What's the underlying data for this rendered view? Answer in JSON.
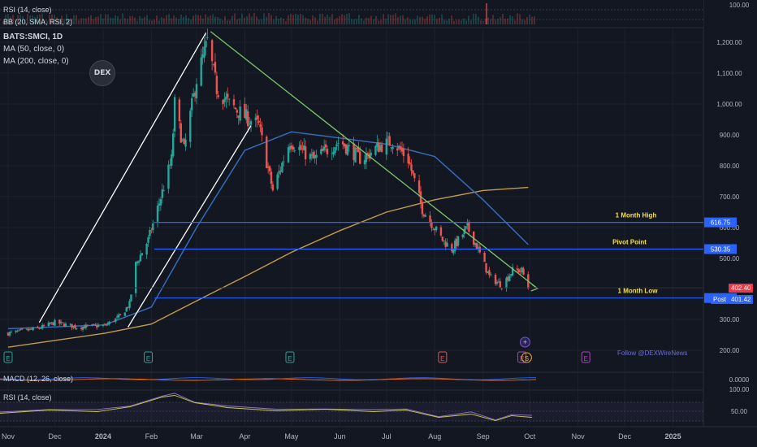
{
  "colors": {
    "background": "#131722",
    "grid": "#1e222d",
    "axis_text": "#b2b5be",
    "candle_up": "#26a69a",
    "candle_down": "#ef5350",
    "ma50": "#3a6fbf",
    "ma200": "#c29c4a",
    "level_line": "#2962ff",
    "trendline_green": "#7cc46b",
    "trendline_white": "#ffffff",
    "level_label": "#f5e342",
    "macd_line": "#2962ff",
    "signal_line": "#ff6d00",
    "rsi_line": "#9575cd",
    "rsi_ma": "#c6cc4a"
  },
  "header": {
    "symbol": "BATS:SMCI, 1D",
    "ma50_label": "MA (50, close, 0)",
    "ma200_label": "MA (200, close, 0)",
    "rsi_top_label": "RSI (14, close)",
    "bb_top_label": "BB (20, SMA, RSI, 2)",
    "macd_label": "MACD (12, 26, close)",
    "rsi_bottom_label": "RSI (14, close)",
    "logo_text": "DEX",
    "follow_text": "Follow @DEXWireNews"
  },
  "chart_data": {
    "type": "candlestick",
    "symbol": "BATS:SMCI",
    "interval": "1D",
    "x_labels": [
      "Nov",
      "Dec",
      "2024",
      "Feb",
      "Mar",
      "Apr",
      "May",
      "Jun",
      "Jul",
      "Aug",
      "Sep",
      "Oct",
      "Nov",
      "Dec",
      "2025"
    ],
    "y_ticks": [
      "1,200.00",
      "1,100.00",
      "1,000.00",
      "900.00",
      "800.00",
      "700.00",
      "600.00",
      "500.00",
      "300.00",
      "200.00"
    ],
    "ylim": [
      180,
      1250
    ],
    "price_path": [
      [
        "2023-11-01",
        255
      ],
      [
        "2023-11-20",
        270
      ],
      [
        "2023-12-01",
        290
      ],
      [
        "2023-12-15",
        275
      ],
      [
        "2024-01-02",
        280
      ],
      [
        "2024-01-12",
        310
      ],
      [
        "2024-01-18",
        350
      ],
      [
        "2024-01-22",
        480
      ],
      [
        "2024-01-30",
        560
      ],
      [
        "2024-02-06",
        680
      ],
      [
        "2024-02-14",
        820
      ],
      [
        "2024-02-16",
        1000
      ],
      [
        "2024-02-22",
        850
      ],
      [
        "2024-03-01",
        1080
      ],
      [
        "2024-03-08",
        1200
      ],
      [
        "2024-03-14",
        1050
      ],
      [
        "2024-03-22",
        1000
      ],
      [
        "2024-04-01",
        960
      ],
      [
        "2024-04-10",
        930
      ],
      [
        "2024-04-19",
        720
      ],
      [
        "2024-04-30",
        880
      ],
      [
        "2024-05-15",
        820
      ],
      [
        "2024-06-01",
        880
      ],
      [
        "2024-06-15",
        820
      ],
      [
        "2024-06-25",
        860
      ],
      [
        "2024-07-05",
        880
      ],
      [
        "2024-07-15",
        820
      ],
      [
        "2024-07-24",
        660
      ],
      [
        "2024-08-06",
        560
      ],
      [
        "2024-08-12",
        530
      ],
      [
        "2024-08-22",
        600
      ],
      [
        "2024-08-28",
        540
      ],
      [
        "2024-09-05",
        440
      ],
      [
        "2024-09-13",
        410
      ],
      [
        "2024-09-20",
        460
      ],
      [
        "2024-09-26",
        460
      ],
      [
        "2024-09-30",
        402
      ]
    ],
    "ma50": [
      [
        "2023-11-01",
        270
      ],
      [
        "2024-01-02",
        282
      ],
      [
        "2024-02-01",
        340
      ],
      [
        "2024-03-01",
        600
      ],
      [
        "2024-04-01",
        850
      ],
      [
        "2024-05-01",
        910
      ],
      [
        "2024-06-01",
        890
      ],
      [
        "2024-07-01",
        870
      ],
      [
        "2024-08-01",
        830
      ],
      [
        "2024-09-01",
        690
      ],
      [
        "2024-09-30",
        545
      ]
    ],
    "ma200": [
      [
        "2023-11-01",
        210
      ],
      [
        "2024-01-02",
        255
      ],
      [
        "2024-02-01",
        285
      ],
      [
        "2024-03-01",
        360
      ],
      [
        "2024-04-01",
        440
      ],
      [
        "2024-05-01",
        520
      ],
      [
        "2024-06-01",
        590
      ],
      [
        "2024-07-01",
        650
      ],
      [
        "2024-08-01",
        690
      ],
      [
        "2024-09-01",
        720
      ],
      [
        "2024-09-30",
        730
      ]
    ],
    "levels": [
      {
        "label": "1 Month High",
        "value": 616.75
      },
      {
        "label": "Pivot Point",
        "value": 530.35
      },
      {
        "label": "1 Month Low",
        "value": 369.24
      }
    ],
    "price_tags": {
      "last": "402.40",
      "post_label": "Post",
      "post": "401.42"
    },
    "trendlines": [
      {
        "color": "green",
        "from": [
          "2024-03-10",
          1235
        ],
        "to": [
          "2024-10-06",
          400
        ]
      },
      {
        "color": "white",
        "from": [
          "2023-11-21",
          290
        ],
        "to": [
          "2024-03-07",
          1230
        ]
      },
      {
        "color": "white",
        "from": [
          "2024-01-17",
          275
        ],
        "to": [
          "2024-04-05",
          930
        ]
      }
    ],
    "top_panel_ticks": [
      "100.00"
    ],
    "macd_ticks": [
      "0.0000"
    ],
    "rsi_ticks": [
      "100.00",
      "50.00"
    ],
    "event_markers": [
      {
        "date": "2023-11-01",
        "label": "E"
      },
      {
        "date": "2024-01-30",
        "label": "E"
      },
      {
        "date": "2024-04-30",
        "label": "E"
      },
      {
        "date": "2024-08-06",
        "label": "E"
      },
      {
        "date": "2024-09-26",
        "label": "E"
      },
      {
        "date": "2024-09-29",
        "label": "S"
      },
      {
        "date": "2024-11-06",
        "label": "E"
      }
    ],
    "grid": true
  }
}
